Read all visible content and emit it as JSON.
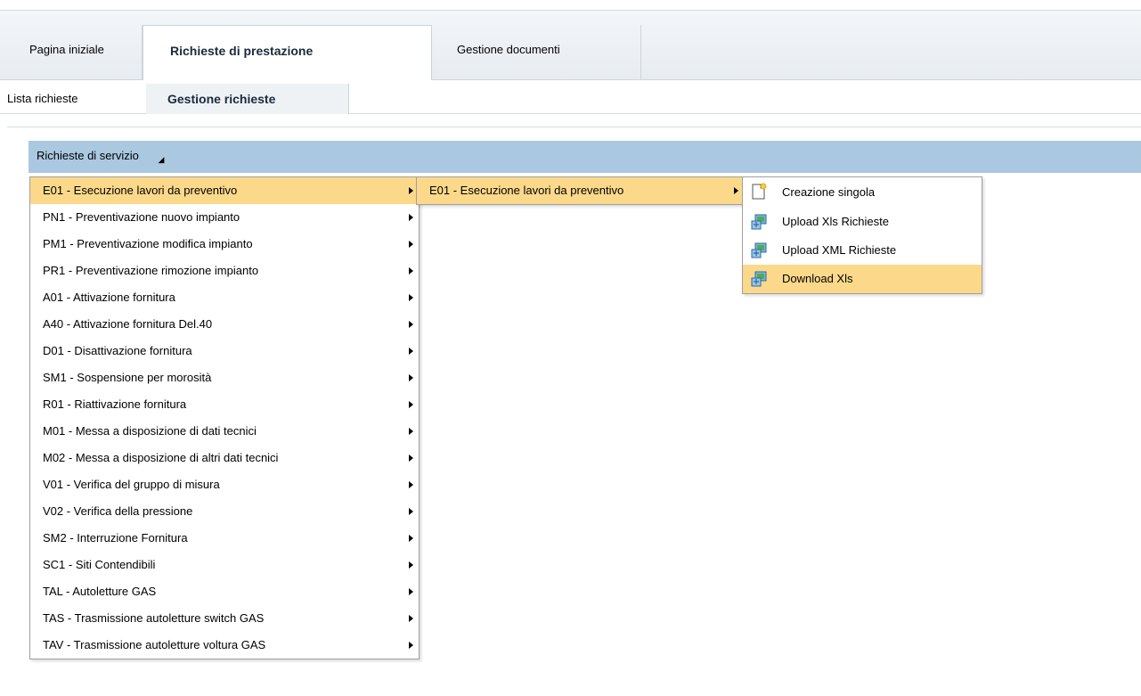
{
  "tabs": {
    "level1": [
      "Pagina iniziale",
      "Richieste di prestazione",
      "Gestione documenti"
    ],
    "level2": [
      "Lista richieste",
      "Gestione richieste"
    ]
  },
  "section": {
    "title": "Richieste di servizio"
  },
  "menu_main": [
    "E01 - Esecuzione lavori da preventivo",
    "PN1 - Preventivazione nuovo impianto",
    "PM1 - Preventivazione modifica impianto",
    "PR1 - Preventivazione rimozione impianto",
    "A01 - Attivazione fornitura",
    "A40 - Attivazione fornitura Del.40",
    "D01 - Disattivazione fornitura",
    "SM1 - Sospensione per morosità",
    "R01 - Riattivazione fornitura",
    "M01 - Messa a disposizione di dati tecnici",
    "M02 - Messa a disposizione di altri dati tecnici",
    "V01 - Verifica del gruppo di misura",
    "V02 - Verifica della pressione",
    "SM2 - Interruzione Fornitura",
    "SC1 - Siti Contendibili",
    "TAL - Autoletture GAS",
    "TAS - Trasmissione autoletture switch GAS",
    "TAV - Trasmissione autoletture voltura GAS"
  ],
  "menu_sub": [
    "E01 - Esecuzione lavori da preventivo"
  ],
  "menu_actions": [
    {
      "label": "Creazione singola",
      "icon": "new-document-icon"
    },
    {
      "label": "Upload Xls Richieste",
      "icon": "upload-icon"
    },
    {
      "label": "Upload XML Richieste",
      "icon": "upload-icon"
    },
    {
      "label": "Download Xls",
      "icon": "download-icon"
    }
  ],
  "colors": {
    "selected": "#fcd98a",
    "header": "#aac8e0"
  }
}
